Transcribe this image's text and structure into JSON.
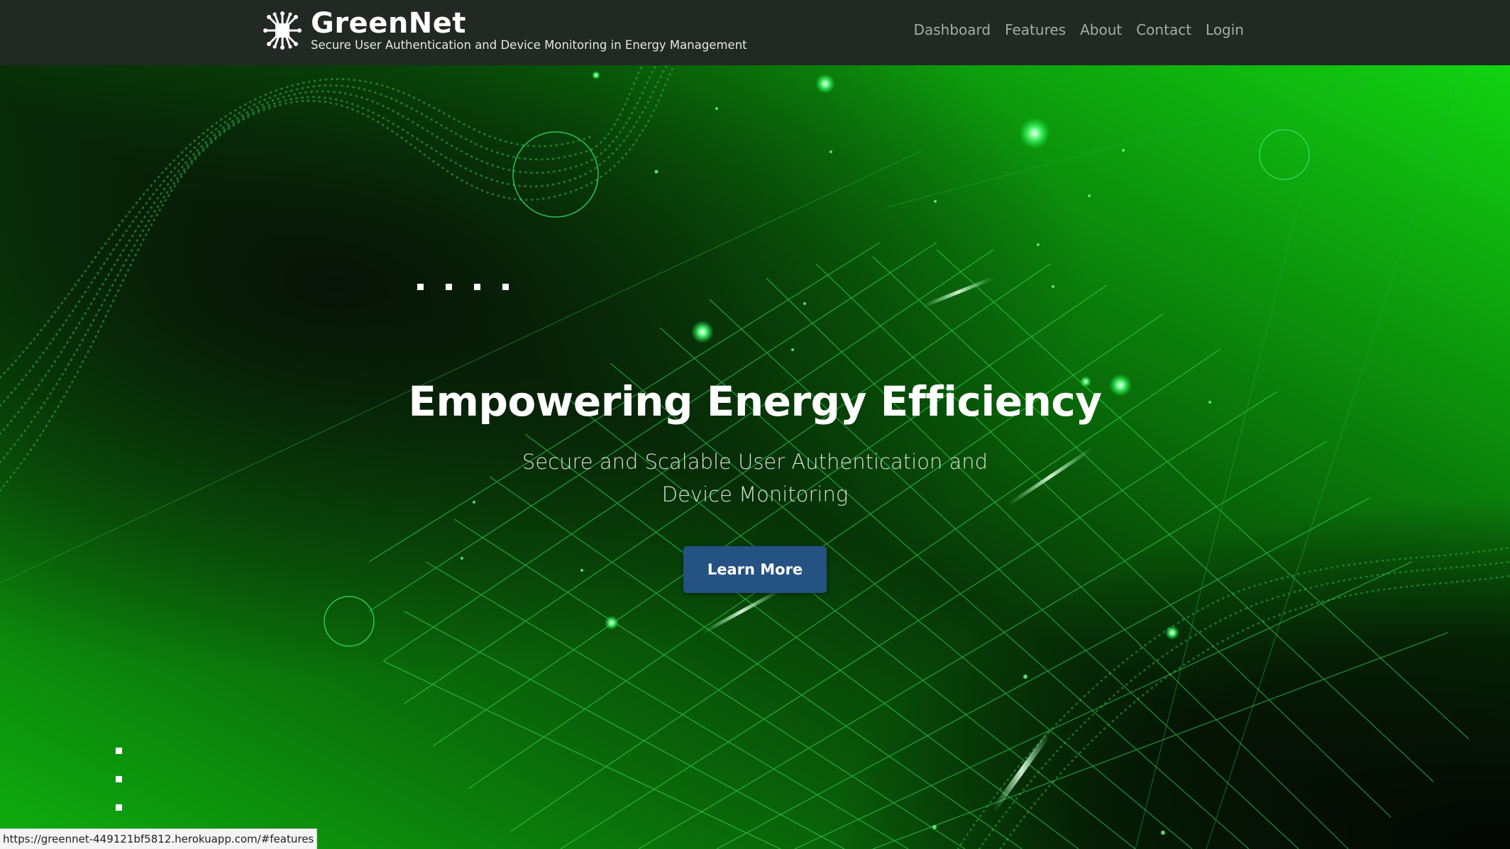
{
  "brand": {
    "title": "GreenNet",
    "tagline": "Secure User Authentication and Device Monitoring in Energy Management",
    "logo_icon": "circuit-chip-icon"
  },
  "nav": {
    "items": [
      {
        "label": "Dashboard"
      },
      {
        "label": "Features"
      },
      {
        "label": "About"
      },
      {
        "label": "Contact"
      },
      {
        "label": "Login"
      }
    ]
  },
  "hero": {
    "title": "Empowering Energy Efficiency",
    "subtitle": "Secure and Scalable User Authentication and Device Monitoring",
    "cta_label": "Learn More"
  },
  "status_bar": {
    "url": "https://greennet-449121bf5812.herokuapp.com/#features"
  },
  "colors": {
    "navbar": "#222823",
    "accent_green": "#00c800",
    "button": "#245283",
    "text": "#ffffff"
  }
}
